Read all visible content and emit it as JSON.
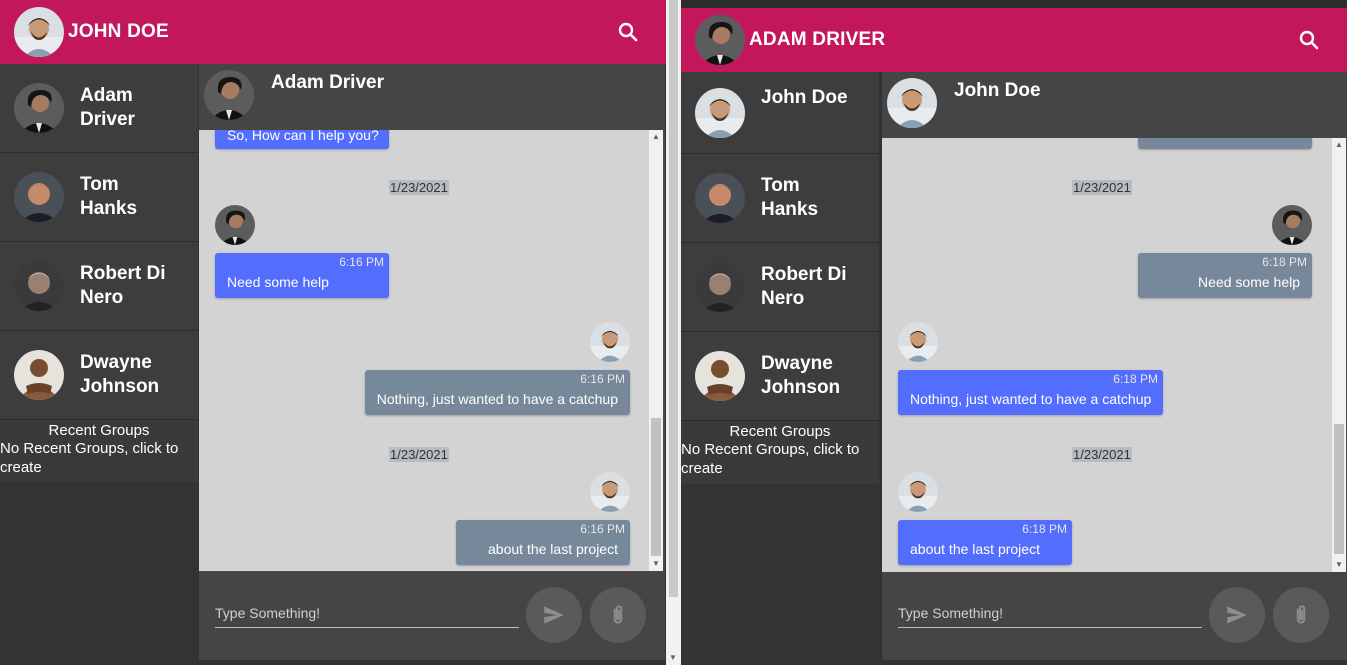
{
  "left": {
    "appbar": {
      "title": "JOHN DOE"
    },
    "contacts": [
      {
        "name": "Adam Driver"
      },
      {
        "name": "Tom Hanks"
      },
      {
        "name": "Robert Di Nero"
      },
      {
        "name": "Dwayne Johnson"
      }
    ],
    "groups": {
      "title": "Recent Groups",
      "cta": "No Recent Groups, click to create"
    },
    "chat": {
      "name": "Adam Driver",
      "partial_message": "So, How can I help you?",
      "dates": [
        "1/23/2021",
        "1/23/2021"
      ],
      "messages": [
        {
          "time": "6:16 PM",
          "text": "Need some help"
        },
        {
          "time": "6:16 PM",
          "text": "Nothing, just wanted to have a catchup"
        },
        {
          "time": "6:16 PM",
          "text": "about the last project"
        }
      ],
      "placeholder": "Type Something!"
    }
  },
  "right": {
    "appbar": {
      "title": "ADAM DRIVER"
    },
    "contacts": [
      {
        "name": "John Doe"
      },
      {
        "name": "Tom Hanks"
      },
      {
        "name": "Robert Di Nero"
      },
      {
        "name": "Dwayne Johnson"
      }
    ],
    "groups": {
      "title": "Recent Groups",
      "cta": "No Recent Groups, click to create"
    },
    "chat": {
      "name": "John Doe",
      "dates": [
        "1/23/2021",
        "1/23/2021"
      ],
      "messages": [
        {
          "time": "6:18 PM",
          "text": "Need some help"
        },
        {
          "time": "6:18 PM",
          "text": "Nothing, just wanted to have a catchup"
        },
        {
          "time": "6:18 PM",
          "text": "about the last project"
        }
      ],
      "placeholder": "Type Something!"
    }
  },
  "colors": {
    "appbar": "#c2185b",
    "sent_bubble": "#536dfe",
    "received_bubble": "#77889a",
    "chat_bg": "#d3d3d3",
    "sidebar_bg": "#3d3d3d"
  },
  "icons": [
    "search-icon",
    "send-icon",
    "attach-icon"
  ]
}
